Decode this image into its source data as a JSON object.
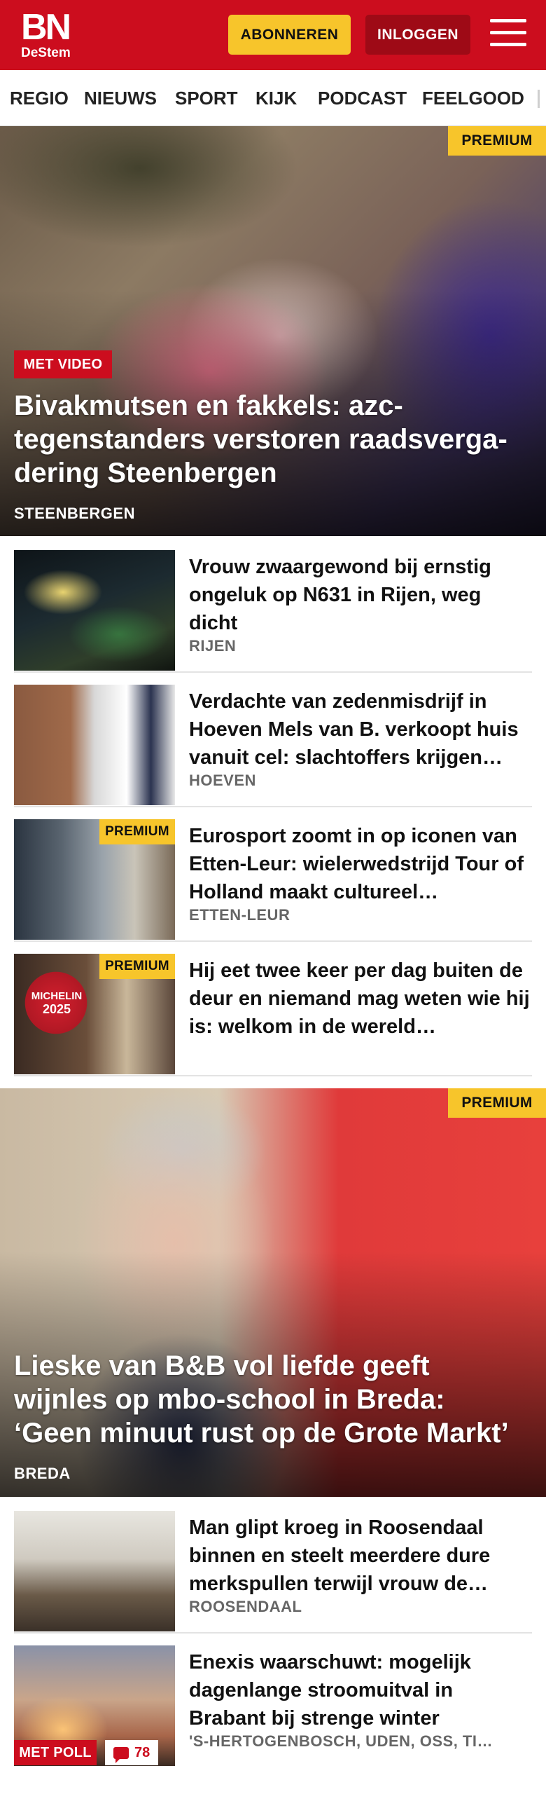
{
  "header": {
    "logo_main": "BN",
    "logo_sub": "DeStem",
    "subscribe_label": "ABONNEREN",
    "login_label": "INLOGGEN",
    "brand_color": "#cc0d1e",
    "accent_color": "#f7c52b"
  },
  "nav": {
    "items": [
      "REGIO",
      "NIEUWS",
      "SPORT",
      "KIJK",
      "PODCAST",
      "FEELGOOD"
    ]
  },
  "hero1": {
    "premium": "PREMIUM",
    "badge": "MET VIDEO",
    "title": "Bivakmutsen en fakkels: azc-tegenstanders verstoren raadsverga­dering Steenbergen",
    "place": "STEENBERGEN"
  },
  "articles": [
    {
      "headline": "Vrouw zwaargewond bij ernstig ongeluk op N631 in Rijen, weg dicht",
      "place": "RIJEN",
      "premium": ""
    },
    {
      "headline": "Verdachte van zedenmisdrijf in Hoeven Mels van B. verkoopt huis vanuit cel: slachtoffers krijgen…",
      "place": "HOEVEN",
      "premium": ""
    },
    {
      "headline": "Eurosport zoomt in op iconen van Etten-Leur: wielerwedstrijd Tour of Holland maakt cultureel…",
      "place": "ETTEN-LEUR",
      "premium": "PREMIUM"
    },
    {
      "headline": "Hij eet twee keer per dag buiten de deur en niemand mag weten wie hij is: welkom in de wereld…",
      "place": "",
      "premium": "PREMIUM",
      "thumb_text_1": "MICHELIN",
      "thumb_text_2": "2025"
    }
  ],
  "hero2": {
    "premium": "PREMIUM",
    "title": "Lieske van B&B vol liefde geeft wijnles op mbo-school in Breda: ‘Geen minuut rust op de Grote Markt’",
    "place": "BREDA"
  },
  "articles2": [
    {
      "headline": "Man glipt kroeg in Roosendaal binnen en steelt meerdere dure merkspullen terwijl vrouw de…",
      "place": "ROOSENDAAL"
    },
    {
      "headline": "Enexis waarschuwt: mogelijk dagenlange stroomuitval in Brabant bij strenge winter",
      "place": "'S-HERTOGENBOSCH, UDEN, OSS, TI…",
      "badge": "MET POLL",
      "comments": "78"
    }
  ]
}
